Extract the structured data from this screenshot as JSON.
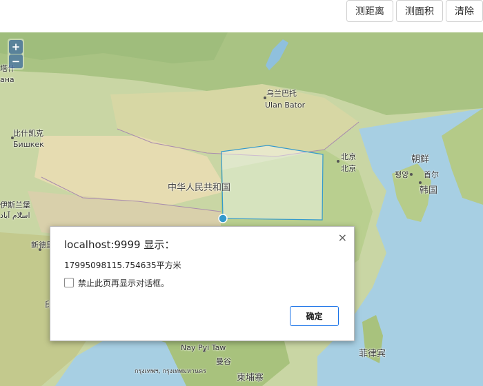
{
  "toolbar": {
    "measure_distance": "测距离",
    "measure_area": "测面积",
    "clear": "清除"
  },
  "zoom": {
    "in": "+",
    "out": "−"
  },
  "map": {
    "labels": {
      "ulan_bator_cn": "乌兰巴托",
      "ulan_bator_en": "Ulan Bator",
      "bishkek_cn": "比什凯克",
      "bishkek_ru": "Бишкек",
      "china": "中华人民共和国",
      "beijing_cn": "北京",
      "beijing_en": "北京",
      "korea": "朝鲜",
      "pyongyang": "평양",
      "seoul": "首尔",
      "south_korea": "韩国",
      "islamabad": "伊斯兰堡",
      "islamabad_ur": "اسلام آباد",
      "new_delhi": "新德里",
      "nay_pyi_taw": "Nay Pyi Taw",
      "bangkok_cn": "曼谷",
      "bangkok_th": "กรุงเทพฯ, กรุงเทพมหานคร",
      "cambodia": "柬埔寨",
      "philippines": "菲律宾",
      "edge_left1": "塔什",
      "edge_left2": "ана",
      "india_edge": "印"
    }
  },
  "dialog": {
    "title": "localhost:9999 显示：",
    "close": "×",
    "message": "17995098115.754635平方米",
    "checkbox_label": "禁止此页再显示对话框。",
    "ok": "确定"
  }
}
